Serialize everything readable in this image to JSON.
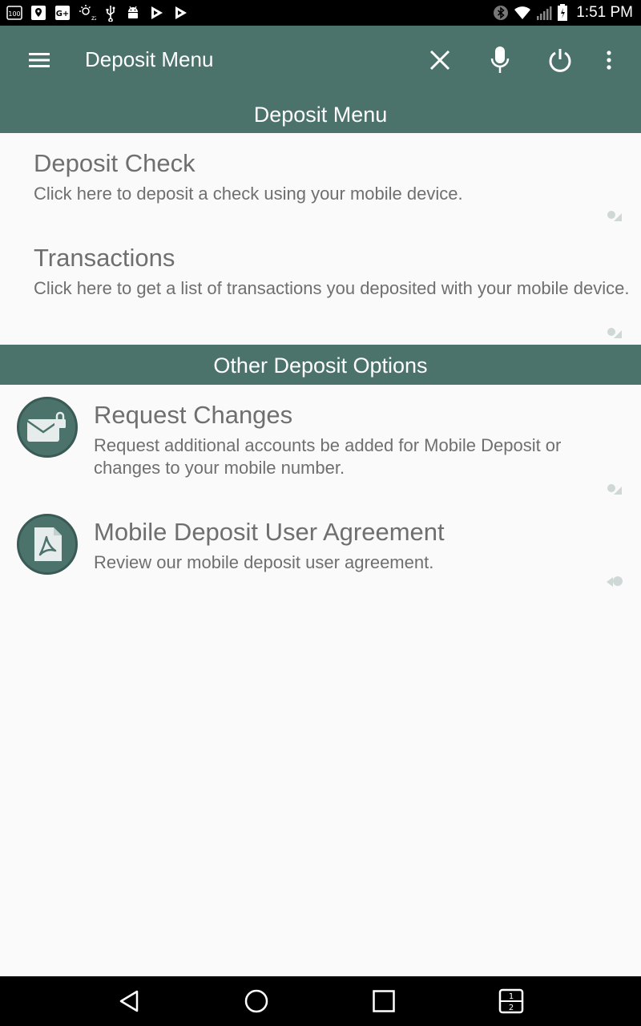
{
  "status_bar": {
    "time": "1:51 PM",
    "left_icons": [
      "100-icon",
      "maps-icon",
      "google-plus-icon",
      "sleep-icon",
      "usb-icon",
      "android-icon",
      "play-store-icon",
      "play-store-icon"
    ],
    "right_icons": [
      "bluetooth-icon",
      "wifi-icon",
      "signal-icon",
      "battery-icon"
    ]
  },
  "app_bar": {
    "title": "Deposit Menu",
    "actions": [
      "close-icon",
      "microphone-icon",
      "power-icon",
      "overflow-menu-icon"
    ]
  },
  "sections": [
    {
      "header": "Deposit Menu",
      "items": [
        {
          "title": "Deposit Check",
          "description": "Click here to deposit a check using your mobile device."
        },
        {
          "title": "Transactions",
          "description": "Click here to get a list of transactions you deposited with your mobile device."
        }
      ]
    },
    {
      "header": "Other Deposit Options",
      "items": [
        {
          "title": "Request Changes",
          "description": "Request additional accounts be added for Mobile Deposit or changes to your mobile number.",
          "icon": "envelope-lock-icon"
        },
        {
          "title": "Mobile Deposit User Agreement",
          "description": "Review our mobile deposit user agreement.",
          "icon": "pdf-document-icon"
        }
      ]
    }
  ],
  "nav_bar": {
    "buttons": [
      "back-icon",
      "home-icon",
      "recents-icon",
      "split-screen-icon"
    ],
    "split_screen_labels": [
      "1",
      "2"
    ]
  },
  "colors": {
    "primary": "#4b736c",
    "text_secondary": "#6f6f6f",
    "background": "#fafafa"
  }
}
